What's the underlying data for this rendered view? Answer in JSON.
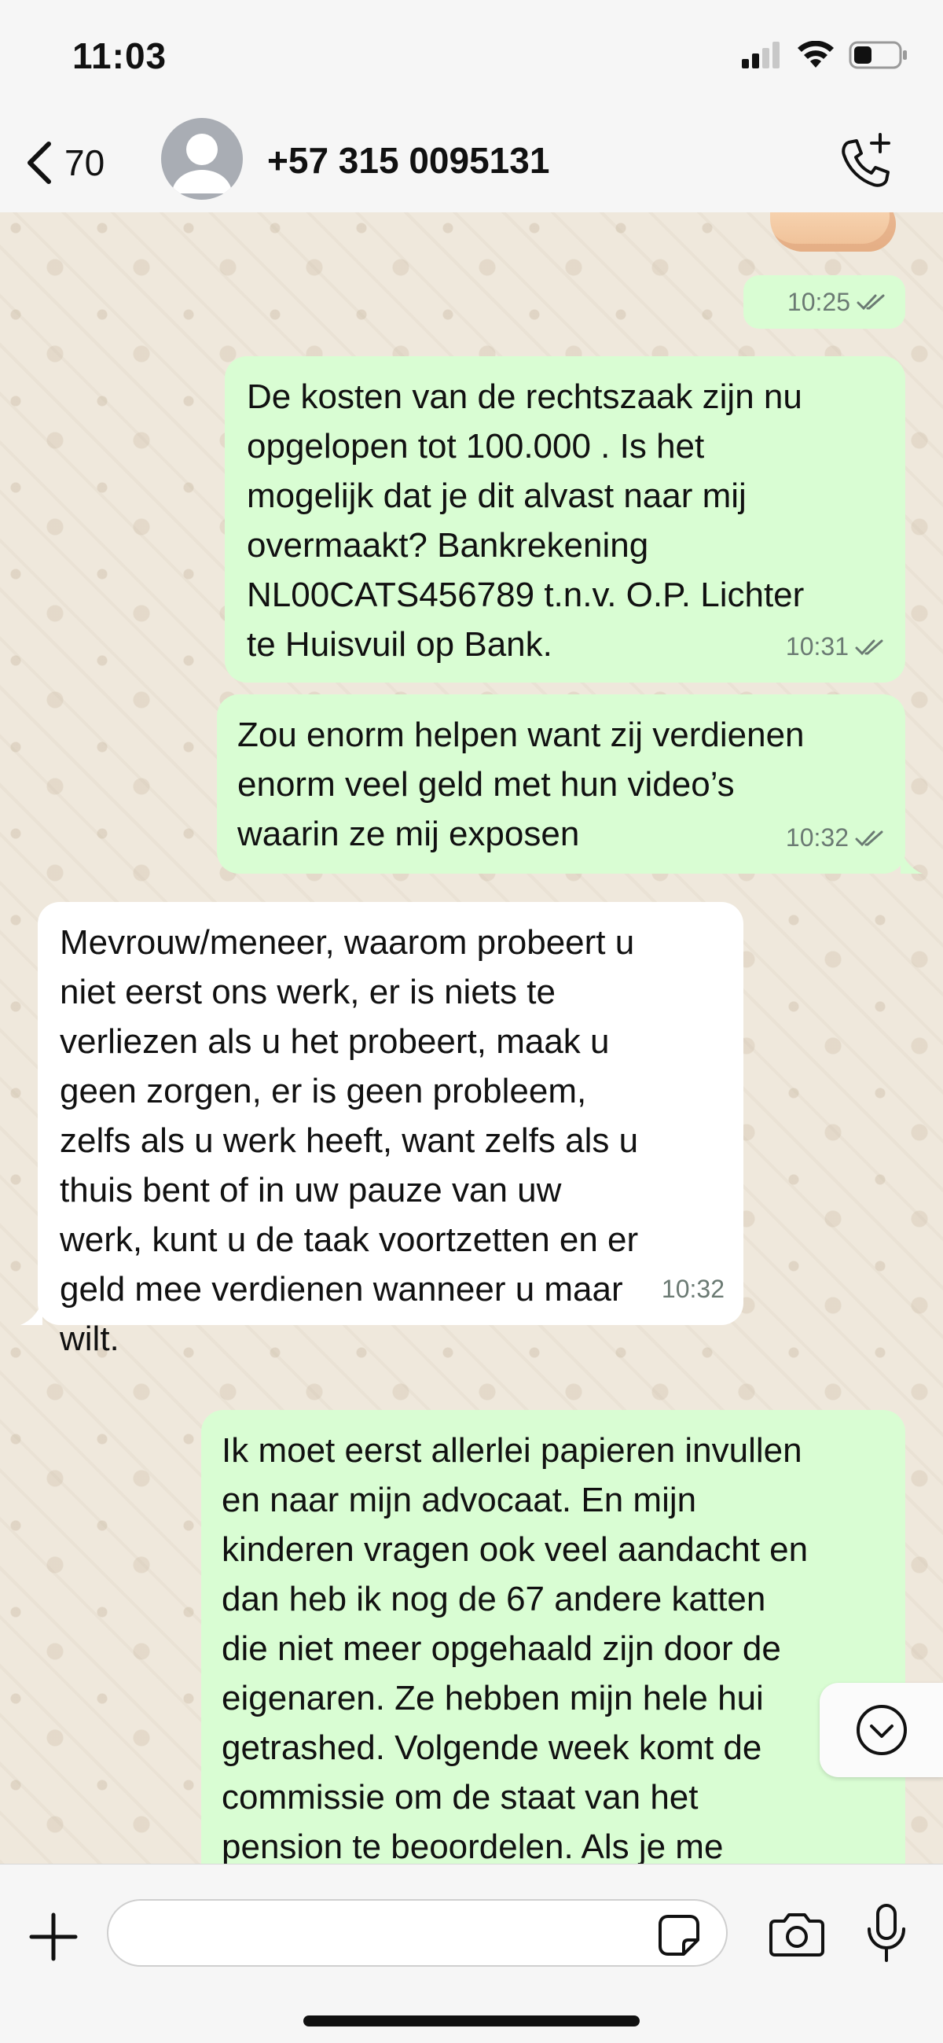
{
  "status_bar": {
    "time": "11:03"
  },
  "header": {
    "back_count": "70",
    "contact_name": "+57 315 0095131"
  },
  "messages": [
    {
      "direction": "outgoing",
      "text": "De kosten van de rechtszaak zijn nu\nopgelopen tot 100.000 . Is het\nmogelijk dat je dit alvast naar mij\novermaakt? Bankrekening\nNL00CATS456789 t.n.v. O.P. Lichter\nte Huisvuil op Bank.",
      "time": "10:31",
      "status": "read"
    },
    {
      "direction": "outgoing",
      "text": "Zou enorm helpen want zij verdienen\nenorm veel geld met hun video’s\nwaarin ze mij exposen",
      "time": "10:32",
      "status": "read"
    },
    {
      "direction": "incoming",
      "text": "Mevrouw/meneer, waarom probeert u\nniet eerst ons werk, er is niets te\nverliezen als u het probeert, maak u\ngeen zorgen, er is geen probleem,\nzelfs als u werk heeft, want zelfs als u\nthuis bent of in uw pauze van uw\nwerk, kunt u de taak voortzetten en er\ngeld mee verdienen wanneer u maar\nwilt.",
      "time": "10:32"
    },
    {
      "direction": "outgoing",
      "text": "Ik moet eerst allerlei papieren invullen\nen naar mijn advocaat. En mijn\nkinderen vragen ook veel aandacht en\ndan heb ik nog de 67 andere katten\ndie niet meer opgehaald zijn door de\neigenaren. Ze hebben mijn hele hui\ngetrashed. Volgende week komt de\ncommissie om de staat van het\npension te beoordelen. Als je me"
    }
  ],
  "top_partial": {
    "time": "10:25",
    "status": "read"
  },
  "composer": {
    "input_value": ""
  },
  "icons": {
    "back": "chevron-left-icon",
    "avatar": "person-icon",
    "call": "phone-add-icon",
    "plus": "plus-icon",
    "sticker": "sticker-icon",
    "camera": "camera-icon",
    "mic": "microphone-icon",
    "scroll": "chevron-down-icon"
  },
  "colors": {
    "outgoing_bubble": "#d9fdd3",
    "incoming_bubble": "#ffffff",
    "chat_background": "#efe8dc",
    "bar_background": "#f6f6f6",
    "tick_color": "#6b7a73"
  }
}
